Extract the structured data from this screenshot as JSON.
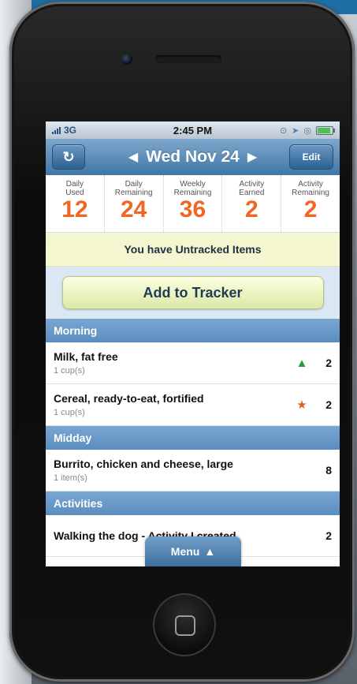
{
  "status_bar": {
    "carrier": "3G",
    "time": "2:45 PM"
  },
  "nav": {
    "date": "Wed Nov 24",
    "edit_label": "Edit",
    "refresh_icon": "refresh-icon",
    "prev_icon": "chevron-left-icon",
    "next_icon": "chevron-right-icon"
  },
  "stats": [
    {
      "label_1": "Daily",
      "label_2": "Used",
      "value": "12"
    },
    {
      "label_1": "Daily",
      "label_2": "Remaining",
      "value": "24"
    },
    {
      "label_1": "Weekly",
      "label_2": "Remaining",
      "value": "36"
    },
    {
      "label_1": "Activity",
      "label_2": "Earned",
      "value": "2"
    },
    {
      "label_1": "Activity",
      "label_2": "Remaining",
      "value": "2"
    }
  ],
  "notice": "You have Untracked Items",
  "add_button": "Add to Tracker",
  "sections": {
    "morning": {
      "title": "Morning",
      "items": [
        {
          "name": "Milk, fat free",
          "serving": "1 cup(s)",
          "value": "2",
          "icon": "up-triangle-icon"
        },
        {
          "name": "Cereal, ready-to-eat, fortified",
          "serving": "1 cup(s)",
          "value": "2",
          "icon": "star-icon"
        }
      ]
    },
    "midday": {
      "title": "Midday",
      "items": [
        {
          "name": "Burrito, chicken and cheese, large",
          "serving": "1 item(s)",
          "value": "8"
        }
      ]
    },
    "activities": {
      "title": "Activities",
      "items": [
        {
          "name": "Walking the dog - Activity I created",
          "value": "2"
        }
      ]
    }
  },
  "menu": {
    "label": "Menu",
    "icon": "up-arrow-icon"
  },
  "colors": {
    "accent_orange": "#f26522",
    "nav_blue": "#3f76a7",
    "notice_yellow": "#f4f6cf",
    "section_blue": "#5a8dbf"
  }
}
